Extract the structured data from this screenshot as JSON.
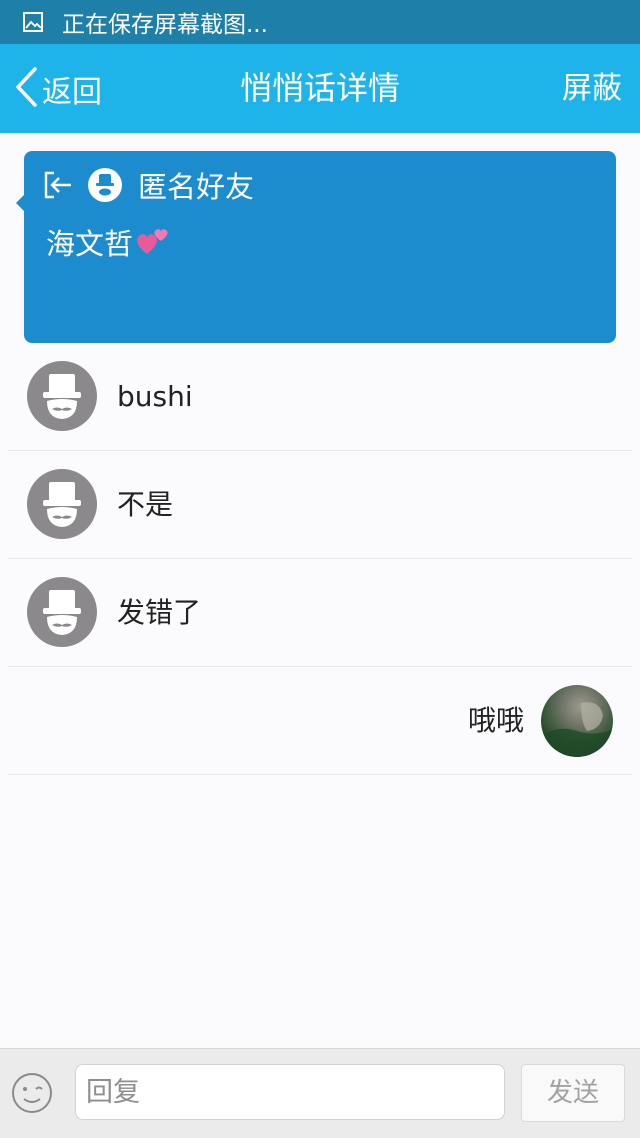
{
  "status_bar": {
    "text": "正在保存屏幕截图...",
    "icon": "image-icon"
  },
  "nav": {
    "back_label": "返回",
    "title": "悄悄话详情",
    "block_label": "屏蔽"
  },
  "whisper": {
    "sender": "匿名好友",
    "message": "海文哲",
    "card_color": "#1c8ccf",
    "icons": [
      "exit-icon",
      "anonymous-avatar-icon",
      "hearts-emoji-icon"
    ]
  },
  "replies": [
    {
      "text": "bushi",
      "from": "anonymous"
    },
    {
      "text": "不是",
      "from": "anonymous"
    },
    {
      "text": "发错了",
      "from": "anonymous"
    },
    {
      "text": "哦哦",
      "from": "me"
    }
  ],
  "input": {
    "placeholder": "回复",
    "send_label": "发送"
  },
  "colors": {
    "status_bar": "#1e7fa9",
    "nav_bar": "#1eb4ea",
    "avatar_gray": "#8b898c"
  }
}
